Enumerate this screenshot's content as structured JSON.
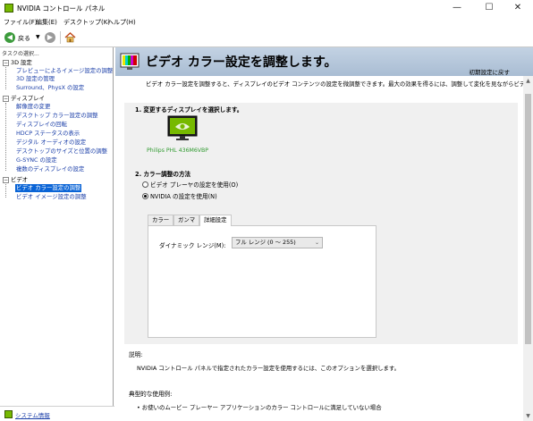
{
  "window": {
    "title": "NVIDIA コントロール パネル",
    "minimize": "—",
    "maximize": "☐",
    "close": "✕"
  },
  "menu": [
    "ファイル(F)",
    "編集(E)",
    "デスクトップ(K)",
    "ヘルプ(H)"
  ],
  "toolbar": {
    "back_label": "戻る"
  },
  "tasks": {
    "header": "タスクの選択...",
    "categories": [
      {
        "label": "3D 設定",
        "items": [
          "プレビューによるイメージ設定の調整",
          "3D 設定の管理",
          "Surround、PhysX の設定"
        ]
      },
      {
        "label": "ディスプレイ",
        "items": [
          "解像度の変更",
          "デスクトップ カラー設定の調整",
          "ディスプレイの回転",
          "HDCP ステータスの表示",
          "デジタル オーディオの設定",
          "デスクトップのサイズと位置の調整",
          "G-SYNC の設定",
          "複数のディスプレイの設定"
        ]
      },
      {
        "label": "ビデオ",
        "items": [
          "ビデオ カラー設定の調整",
          "ビデオ イメージ設定の調整"
        ]
      }
    ]
  },
  "system_info": "システム情報",
  "page": {
    "title": "ビデオ カラー設定を調整します。",
    "restore_defaults": "初期設定に戻す",
    "intro": "ビデオ カラー設定を調整すると、ディスプレイのビデオ コンテンツの設定を微調整できます。最大の効果を得るには、調整して変化を見ながらビデ",
    "step1": "1. 変更するディスプレイを選択します。",
    "display_name": "Philips PHL 436M6VBP",
    "step2": "2. カラー調整の方法",
    "radio_player": "ビデオ プレーヤの設定を使用(O)",
    "radio_nvidia": "NVIDIA の設定を使用(N)",
    "tabs": [
      "カラー",
      "ガンマ",
      "詳細設定"
    ],
    "dynamic_range_label": "ダイナミック レンジ(M):",
    "dynamic_range_value": "フル レンジ (0 〜 255)",
    "description_label": "説明:",
    "description_text": "NVIDIA コントロール パネルで指定されたカラー設定を使用するには、このオプションを選択します。",
    "typical_label": "典型的な使用例:",
    "typical_text": "• お使いのムービー プレーヤー アプリケーションのカラー コントロールに満足していない場合"
  }
}
